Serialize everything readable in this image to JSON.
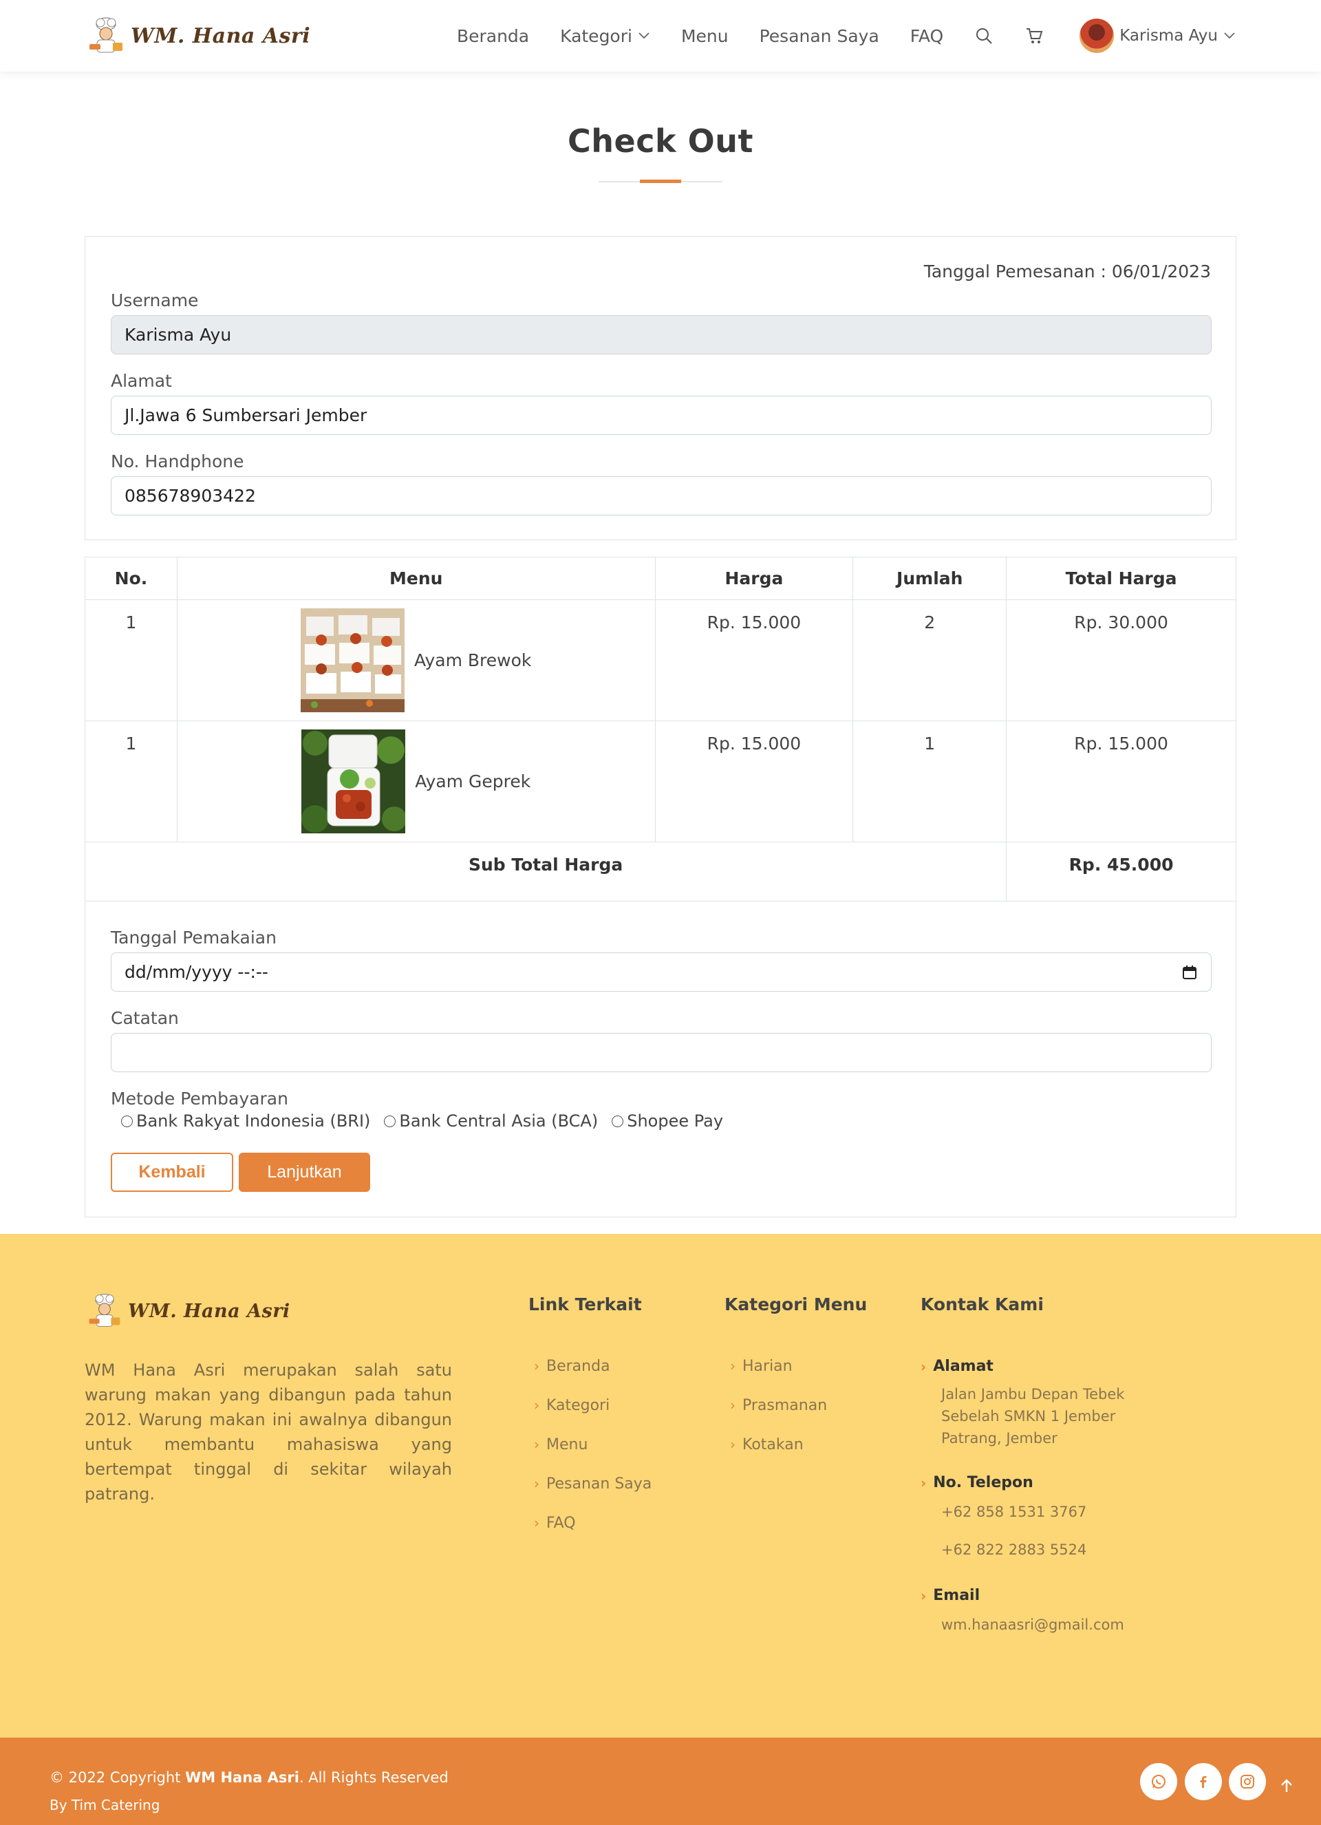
{
  "header": {
    "brand": "WM. Hana Asri",
    "nav": [
      "Beranda",
      "Kategori",
      "Menu",
      "Pesanan Saya",
      "FAQ"
    ],
    "user_name": "Karisma Ayu"
  },
  "page": {
    "title": "Check Out"
  },
  "customer": {
    "order_date_label": "Tanggal Pemesanan : 06/01/2023",
    "username_label": "Username",
    "username_value": "Karisma Ayu",
    "address_label": "Alamat",
    "address_value": "Jl.Jawa 6 Sumbersari Jember",
    "phone_label": "No. Handphone",
    "phone_value": "085678903422"
  },
  "table": {
    "headers": [
      "No.",
      "Menu",
      "Harga",
      "Jumlah",
      "Total Harga"
    ],
    "rows": [
      {
        "no": "1",
        "menu": "Ayam Brewok",
        "price": "Rp. 15.000",
        "qty": "2",
        "total": "Rp. 30.000"
      },
      {
        "no": "1",
        "menu": "Ayam Geprek",
        "price": "Rp. 15.000",
        "qty": "1",
        "total": "Rp. 15.000"
      }
    ],
    "subtotal_label": "Sub Total Harga",
    "subtotal_value": "Rp. 45.000"
  },
  "order_form": {
    "usage_date_label": "Tanggal Pemakaian",
    "usage_date_placeholder": "dd/mm/yyyy --:--",
    "notes_label": "Catatan",
    "notes_value": "",
    "payment_label": "Metode Pembayaran",
    "payment_options": [
      "Bank Rakyat Indonesia (BRI)",
      "Bank Central Asia (BCA)",
      "Shopee Pay"
    ],
    "back_button": "Kembali",
    "next_button": "Lanjutkan"
  },
  "footer": {
    "brand": "WM. Hana Asri",
    "description": "WM Hana Asri merupakan salah satu warung makan yang dibangun pada tahun 2012. Warung makan ini awalnya dibangun untuk membantu mahasiswa yang bertempat tinggal di sekitar wilayah patrang.",
    "links_title": "Link Terkait",
    "links": [
      "Beranda",
      "Kategori",
      "Menu",
      "Pesanan Saya",
      "FAQ"
    ],
    "categories_title": "Kategori Menu",
    "categories": [
      "Harian",
      "Prasmanan",
      "Kotakan"
    ],
    "contact_title": "Kontak Kami",
    "address_head": "Alamat",
    "address_lines": [
      "Jalan Jambu Depan Tebek",
      "Sebelah SMKN 1 Jember",
      "Patrang, Jember"
    ],
    "phone_head": "No. Telepon",
    "phones": [
      "+62 858 1531 3767",
      "+62 822 2883 5524"
    ],
    "email_head": "Email",
    "email": "wm.hanaasri@gmail.com"
  },
  "bottom_bar": {
    "copyright_prefix": "© 2022 Copyright ",
    "copyright_brand": "WM Hana Asri",
    "copyright_suffix": ". All Rights Reserved",
    "by": "By Tim Catering",
    "social": [
      "whatsapp-icon",
      "facebook-icon",
      "instagram-icon"
    ]
  },
  "colors": {
    "accent": "#e6843b",
    "footer_bg": "#fdd775"
  }
}
